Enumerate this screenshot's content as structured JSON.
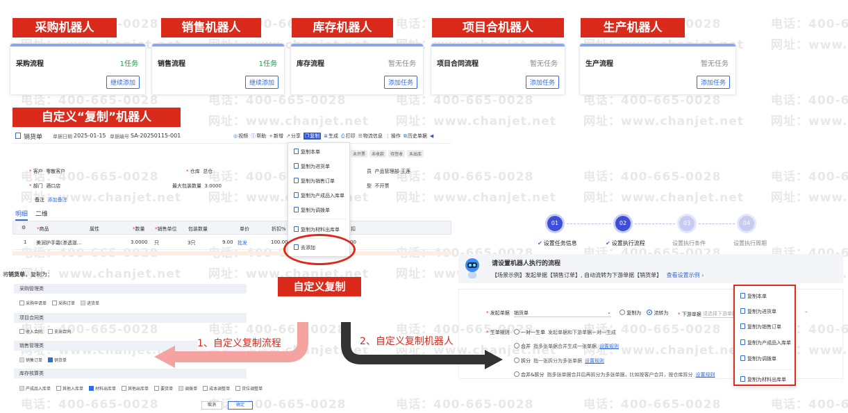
{
  "watermarks": {
    "phone": "电话：400-665-0028",
    "site": "网址：www.chanjet.net"
  },
  "robots": [
    {
      "title": "采购机器人",
      "flow": "采购流程",
      "count": "1任务",
      "button": "继续添加",
      "count_color": "#1a9a4b"
    },
    {
      "title": "销售机器人",
      "flow": "销售流程",
      "count": "1任务",
      "button": "继续添加",
      "count_color": "#1a9a4b"
    },
    {
      "title": "库存机器人",
      "flow": "库存流程",
      "count": "暂无任务",
      "button": "添加任务",
      "count_color": "#888888"
    },
    {
      "title": "项目合机器人",
      "flow": "项目合同流程",
      "count": "暂无任务",
      "button": "添加任务",
      "count_color": "#888888"
    },
    {
      "title": "生产机器人",
      "flow": "生产流程",
      "count": "暂无任务",
      "button": "添加任务",
      "count_color": "#888888"
    }
  ],
  "custom_copy_title": "自定义“复制”机器人",
  "doc": {
    "name": "销货单",
    "date_label": "单据日期",
    "date": "2025-01-15",
    "no_label": "单据编号",
    "no": "SA-20250115-001",
    "toolbar": [
      "视频",
      "帮助",
      "新增",
      "分享",
      "复制",
      "生成",
      "打印",
      "物流信息",
      "操作",
      "历史单据"
    ],
    "statuses": [
      "未开票",
      "未收款",
      "待签收",
      "未出库"
    ],
    "customer_label": "客户",
    "customer": "零散客户",
    "warehouse_label": "仓库",
    "warehouse": "总仓",
    "dept_label": "部门",
    "dept": "酒口店",
    "max_pack_label": "最大包装数量",
    "max_pack": "3.0000",
    "salesman_label": "员",
    "salesman": "产品管理部-王莲",
    "invoice_label": "型",
    "invoice": "不开票",
    "remark_label": "备注",
    "remark_link": "添加备注",
    "tabs": [
      "明细",
      "二维"
    ],
    "table_headers": [
      "商品",
      "属性",
      "数量",
      "销售单位",
      "包装数量",
      "单价",
      "折扣%",
      "扣"
    ],
    "row": {
      "idx": "1",
      "product": "美润护手霜(渗透滋...",
      "qty": "3.0000",
      "unit": "只",
      "pack": "3只",
      "price": "9.00",
      "price_tag": "批发",
      "discount": "100.00",
      "tail": "00"
    }
  },
  "copy_menu": [
    "复制本单",
    "复制为进货单",
    "复制为销售订单",
    "复制为产成品入库单",
    "复制为调拨单",
    "复制为材料出库单",
    "去添加"
  ],
  "custom_copy_label": "自定义复制",
  "copy_settings": {
    "prefix": "将",
    "doc": "销货单",
    "suffix": "，复制为：",
    "groups": [
      {
        "name": "采购管理类",
        "options": [
          {
            "label": "采购申请单",
            "state": "off"
          },
          {
            "label": "采购订单",
            "state": "off"
          },
          {
            "label": "进货单",
            "state": "gray"
          }
        ]
      },
      {
        "name": "项目合同类",
        "options": [
          {
            "label": "收入合同",
            "state": "off"
          },
          {
            "label": "支出合同",
            "state": "off"
          }
        ]
      },
      {
        "name": "销售管理类",
        "options": [
          {
            "label": "销售订单",
            "state": "gray"
          },
          {
            "label": "销货单",
            "state": "on"
          }
        ]
      },
      {
        "name": "库存核算类",
        "options": [
          {
            "label": "产成品入库单",
            "state": "gray"
          },
          {
            "label": "其他入库单",
            "state": "off"
          },
          {
            "label": "材料出库单",
            "state": "on"
          },
          {
            "label": "其他出库单",
            "state": "off"
          },
          {
            "label": "要货单",
            "state": "off"
          },
          {
            "label": "调拨单",
            "state": "gray"
          },
          {
            "label": "成本调整单",
            "state": "off"
          },
          {
            "label": "货位调整单",
            "state": "off"
          }
        ]
      }
    ],
    "cancel": "取消",
    "confirm": "确定"
  },
  "arrow1_label": "1、自定义复制流程",
  "arrow2_label": "2、自定义复制机器人",
  "wizard": {
    "steps": [
      {
        "num": "01",
        "label": "设置任务信息",
        "done": true
      },
      {
        "num": "02",
        "label": "设置执行流程",
        "done": true
      },
      {
        "num": "03",
        "label": "设置执行条件",
        "done": false
      },
      {
        "num": "04",
        "label": "设置执行周期",
        "done": false
      }
    ],
    "heading": "请设置机器人执行的流程",
    "example": "【场景示例】发起单据【销售订单】, 自动流转为下游单据【销货单】",
    "example_link": "查看设置示例 ›",
    "start_label": "发起单据",
    "start_value": "销货单",
    "copy_as": "复制为",
    "flow_as": "流转为",
    "downstream_label": "下游单据",
    "downstream_placeholder": "请选择下游单据",
    "gen_rule_label": "生单规则",
    "rules": [
      {
        "name": "一对一生单",
        "desc": "发起单据和下游单据一对一生成",
        "link": ""
      },
      {
        "name": "合并",
        "desc": "指多张单据合并生成一张单据",
        "link": "设置规则"
      },
      {
        "name": "拆分",
        "desc": "指一张拆分为多张单据",
        "link": "设置规则"
      },
      {
        "name": "合并&拆分",
        "desc": "指多张单据合并后再拆分为多张单据，比如按客户合并，按仓库拆分",
        "link": "设置规则"
      }
    ],
    "dropdown": [
      "复制本单",
      "复制为进货单",
      "复制为销售订单",
      "复制为产成品入库单",
      "复制为调拨单",
      "复制为材料出库单"
    ]
  },
  "colors": {
    "brand_red": "#d92a1c",
    "accent_blue": "#2f6ae0",
    "step_blue": "#3d4fd6"
  }
}
